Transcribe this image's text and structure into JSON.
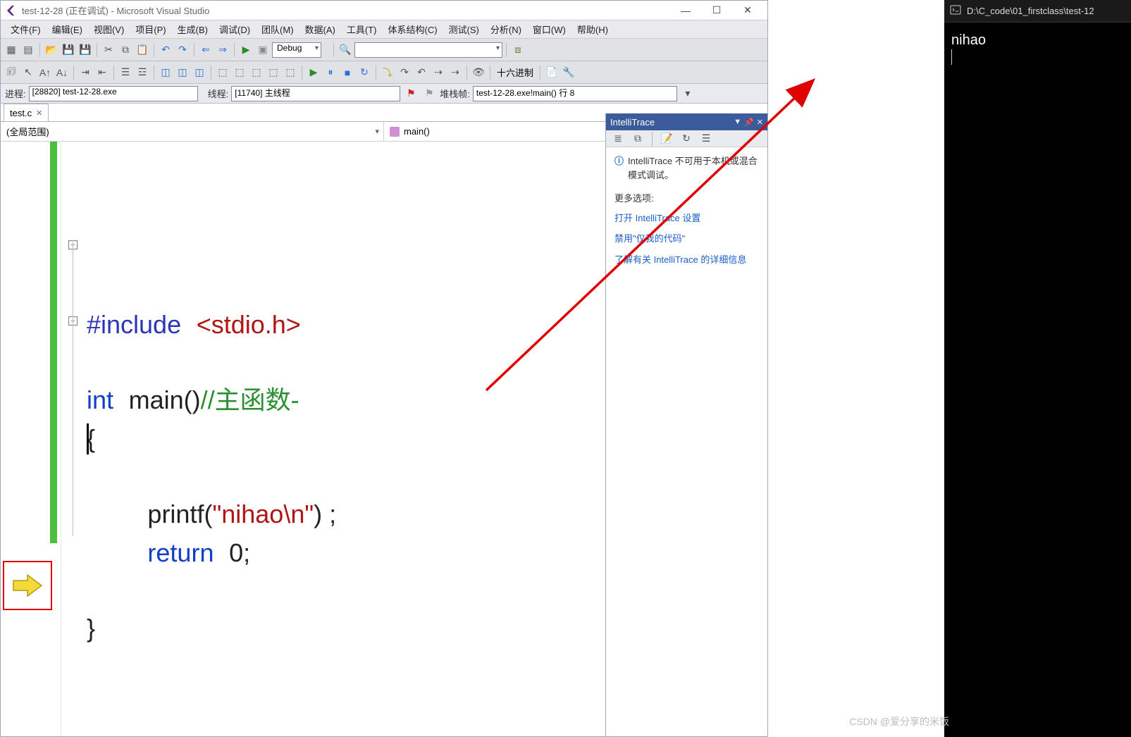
{
  "window": {
    "title": "test-12-28 (正在调试) - Microsoft Visual Studio"
  },
  "menus": {
    "file": "文件(F)",
    "edit": "编辑(E)",
    "view": "视图(V)",
    "project": "项目(P)",
    "build": "生成(B)",
    "debug": "调试(D)",
    "team": "团队(M)",
    "data": "数据(A)",
    "tools": "工具(T)",
    "arch": "体系结构(C)",
    "test": "测试(S)",
    "analyze": "分析(N)",
    "window": "窗口(W)",
    "help": "帮助(H)"
  },
  "toolbar": {
    "config": "Debug",
    "hex": "十六进制"
  },
  "debug": {
    "process_label": "进程:",
    "process": "[28820] test-12-28.exe",
    "thread_label": "线程:",
    "thread": "[11740] 主线程",
    "stack_label": "堆栈帧:",
    "stack": "test-12-28.exe!main() 行 8"
  },
  "tab": {
    "name": "test.c"
  },
  "scope": {
    "left": "(全局范围)",
    "right": "main()"
  },
  "code": {
    "inc_kw": "#include",
    "inc_arg": "<stdio.h>",
    "int": "int",
    "main": "main()",
    "cmt": "//主函数-",
    "lbrace": "{",
    "printf": "printf(",
    "str": "\"nihao\\n\"",
    "printf_end": ") ;",
    "ret": "return",
    "zero": "0;",
    "rbrace": "}"
  },
  "itrace": {
    "title": "IntelliTrace",
    "msg": "IntelliTrace 不可用于本机或混合模式调试。",
    "more": "更多选项:",
    "link1": "打开 IntelliTrace 设置",
    "link2": "禁用\"仅我的代码\"",
    "link3": "了解有关 IntelliTrace 的详细信息"
  },
  "console": {
    "path": "D:\\C_code\\01_firstclass\\test-12",
    "output": "nihao"
  },
  "watermark": "CSDN @爱分享的米饭"
}
